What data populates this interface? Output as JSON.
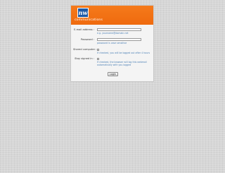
{
  "logo": {
    "mark": "nw",
    "text": "communications"
  },
  "form": {
    "email_label": "E-mail address :",
    "email_value": "",
    "email_hint": "e.g. yourname@domain.net",
    "password_label": "Password :",
    "password_value": "",
    "password_hint": "password is case sensitive",
    "shared_label": "Shared computer :",
    "shared_checked": false,
    "shared_hint": "If checked, you will be logged out after 4 hours",
    "stay_label": "Stay signed in :",
    "stay_checked": false,
    "stay_hint_1": "If checked, the browser will log this webmail",
    "stay_hint_2": "automatically with you logged",
    "login_label": "Login"
  },
  "colors": {
    "banner": "#f26f12",
    "logo_box": "#1f5aa6",
    "hint_text": "#4a7fb5",
    "background": "#d6d6d6"
  }
}
